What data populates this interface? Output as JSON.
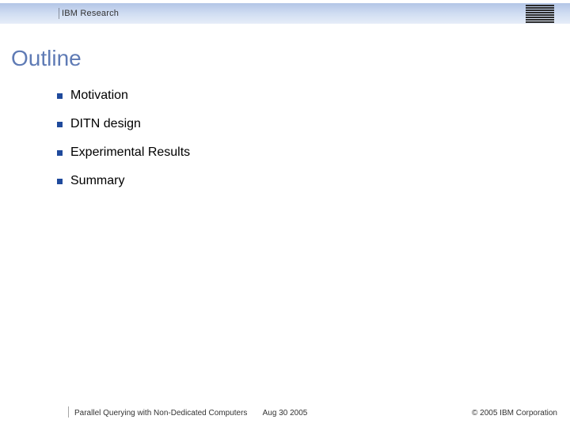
{
  "header": {
    "org_label": "IBM Research",
    "logo_name": "ibm-logo"
  },
  "title": "Outline",
  "outline": {
    "items": [
      {
        "label": "Motivation"
      },
      {
        "label": "DITN design"
      },
      {
        "label": "Experimental Results"
      },
      {
        "label": "Summary"
      }
    ]
  },
  "footer": {
    "left": "Parallel Querying with Non-Dedicated Computers",
    "center": "Aug 30 2005",
    "right": "© 2005 IBM Corporation"
  },
  "colors": {
    "title": "#5f7bb5",
    "bullet": "#1f4a9c",
    "header_gradient_top": "#b3c5e6",
    "header_gradient_bottom": "#e6edf8"
  }
}
